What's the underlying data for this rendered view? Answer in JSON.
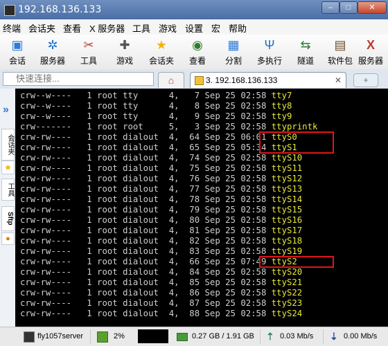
{
  "window": {
    "title": "192.168.136.133"
  },
  "menu": [
    "终端",
    "会话夹",
    "查看",
    "X 服务器",
    "工具",
    "游戏",
    "设置",
    "宏",
    "帮助"
  ],
  "toolbar": {
    "items": [
      {
        "label": "会话",
        "icon": "session-icon",
        "color": "#2e7bd6"
      },
      {
        "label": "服务器",
        "icon": "servers-icon",
        "color": "#1e73c8"
      },
      {
        "label": "工具",
        "icon": "tools-icon",
        "color": "#c0392b"
      },
      {
        "label": "游戏",
        "icon": "games-icon",
        "color": "#555555"
      },
      {
        "label": "会话夹",
        "icon": "star-icon",
        "color": "#f1b400"
      },
      {
        "label": "查看",
        "icon": "view-icon",
        "color": "#2d7d2d"
      },
      {
        "label": "分割",
        "icon": "split-icon",
        "color": "#2e7bd6"
      },
      {
        "label": "多执行",
        "icon": "multiexec-icon",
        "color": "#1e73c8"
      },
      {
        "label": "隧道",
        "icon": "tunnel-icon",
        "color": "#2d7d2d"
      },
      {
        "label": "软件包",
        "icon": "package-icon",
        "color": "#6e4c2a"
      },
      {
        "label": "服务器",
        "icon": "xserver-icon",
        "color": "#c0392b"
      }
    ]
  },
  "quick_connect": {
    "placeholder": "快速连接..."
  },
  "tabs": {
    "session_label": "3. 192.168.136.133",
    "close": "✕",
    "add": "+"
  },
  "sidebar": {
    "items": [
      "会话夹",
      "工具",
      "Sftp"
    ]
  },
  "terminal": {
    "lines": [
      {
        "t": "crw--w----   1 root tty      4,   7 Sep 25 02:58 ",
        "dev": "tty7"
      },
      {
        "t": "crw--w----   1 root tty      4,   8 Sep 25 02:58 ",
        "dev": "tty8"
      },
      {
        "t": "crw--w----   1 root tty      4,   9 Sep 25 02:58 ",
        "dev": "tty9"
      },
      {
        "t": "crw-------   1 root root     5,   3 Sep 25 02:58 ",
        "dev": "ttyprintk"
      },
      {
        "t": "crw-rw----   1 root dialout  4,  64 Sep 25 06:01 ",
        "dev": "ttyS0"
      },
      {
        "t": "crw-rw----   1 root dialout  4,  65 Sep 25 05:34 ",
        "dev": "ttyS1"
      },
      {
        "t": "crw-rw----   1 root dialout  4,  74 Sep 25 02:58 ",
        "dev": "ttyS10"
      },
      {
        "t": "crw-rw----   1 root dialout  4,  75 Sep 25 02:58 ",
        "dev": "ttyS11"
      },
      {
        "t": "crw-rw----   1 root dialout  4,  76 Sep 25 02:58 ",
        "dev": "ttyS12"
      },
      {
        "t": "crw-rw----   1 root dialout  4,  77 Sep 25 02:58 ",
        "dev": "ttyS13"
      },
      {
        "t": "crw-rw----   1 root dialout  4,  78 Sep 25 02:58 ",
        "dev": "ttyS14"
      },
      {
        "t": "crw-rw----   1 root dialout  4,  79 Sep 25 02:58 ",
        "dev": "ttyS15"
      },
      {
        "t": "crw-rw----   1 root dialout  4,  80 Sep 25 02:58 ",
        "dev": "ttyS16"
      },
      {
        "t": "crw-rw----   1 root dialout  4,  81 Sep 25 02:58 ",
        "dev": "ttyS17"
      },
      {
        "t": "crw-rw----   1 root dialout  4,  82 Sep 25 02:58 ",
        "dev": "ttyS18"
      },
      {
        "t": "crw-rw----   1 root dialout  4,  83 Sep 25 02:58 ",
        "dev": "ttyS19"
      },
      {
        "t": "crw-rw----   1 root dialout  4,  66 Sep 25 07:49 ",
        "dev": "ttyS2"
      },
      {
        "t": "crw-rw----   1 root dialout  4,  84 Sep 25 02:58 ",
        "dev": "ttyS20"
      },
      {
        "t": "crw-rw----   1 root dialout  4,  85 Sep 25 02:58 ",
        "dev": "ttyS21"
      },
      {
        "t": "crw-rw----   1 root dialout  4,  86 Sep 25 02:58 ",
        "dev": "ttyS22"
      },
      {
        "t": "crw-rw----   1 root dialout  4,  87 Sep 25 02:58 ",
        "dev": "ttyS23"
      },
      {
        "t": "crw-rw----   1 root dialout  4,  88 Sep 25 02:58 ",
        "dev": "ttyS24"
      }
    ],
    "highlight_color": "#e0161b"
  },
  "status": {
    "server": "fly1057server",
    "cpu": "2%",
    "memory": "0.27 GB / 1.91 GB",
    "upload": "0.03 Mb/s",
    "download": "0.00 Mb/s"
  }
}
